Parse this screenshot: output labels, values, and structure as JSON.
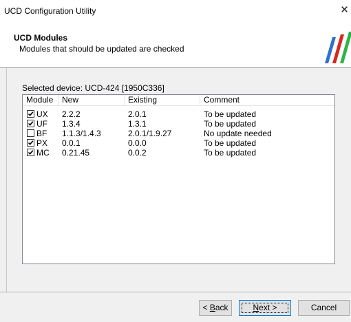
{
  "window": {
    "title": "UCD Configuration Utility",
    "close_glyph": "✕"
  },
  "header": {
    "title": "UCD Modules",
    "subtitle": "Modules that should be updated are checked",
    "logo_icon": "brand-stripes-icon",
    "logo_colors": [
      "#2f6fd0",
      "#d6281e",
      "#2fb34a"
    ]
  },
  "device_label": "Selected device: UCD-424 [1950C336]",
  "table": {
    "columns": [
      "Module",
      "New",
      "Existing",
      "Comment"
    ],
    "rows": [
      {
        "checked": true,
        "module": "UX",
        "new": "2.2.2",
        "existing": "2.0.1",
        "comment": "To be updated"
      },
      {
        "checked": true,
        "module": "UF",
        "new": "1.3.4",
        "existing": "1.3.1",
        "comment": "To be updated"
      },
      {
        "checked": false,
        "module": "BF",
        "new": "1.1.3/1.4.3",
        "existing": "2.0.1/1.9.27",
        "comment": "No update needed"
      },
      {
        "checked": true,
        "module": "PX",
        "new": "0.0.1",
        "existing": "0.0.0",
        "comment": "To be updated"
      },
      {
        "checked": true,
        "module": "MC",
        "new": "0.21.45",
        "existing": "0.0.2",
        "comment": "To be updated"
      }
    ]
  },
  "buttons": {
    "back_mnemonic": "B",
    "back_rest": "ack",
    "back_prefix": "< ",
    "next_mnemonic": "N",
    "next_rest": "ext >",
    "cancel": "Cancel"
  }
}
